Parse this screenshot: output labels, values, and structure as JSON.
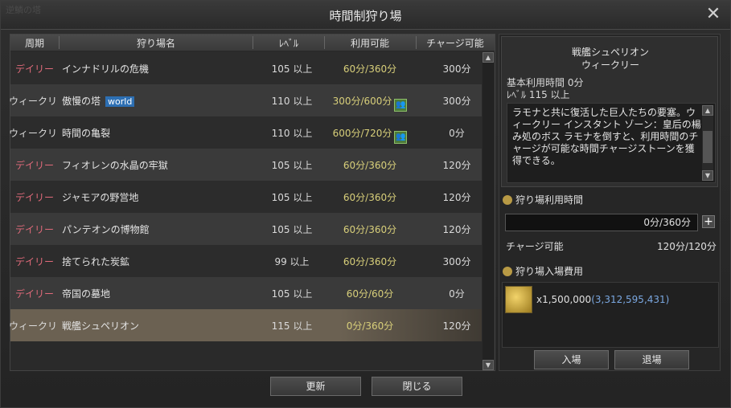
{
  "window": {
    "title": "時間制狩り場",
    "background_ghost_text": "逆鱗の塔"
  },
  "table": {
    "headers": [
      "周期",
      "狩り場名",
      "ﾚﾍﾞﾙ",
      "利用可能",
      "チャージ可能"
    ],
    "rows": [
      {
        "period": "デイリー",
        "period_type": "daily",
        "name": "インナドリルの危機",
        "badge": "",
        "party": false,
        "level": "105  以上",
        "usage": "60分/360分",
        "charge": "300分"
      },
      {
        "period": "ウィークリ",
        "period_type": "weekly",
        "name": "傲慢の塔",
        "badge": "world",
        "party": true,
        "level": "110  以上",
        "usage": "300分/600分",
        "charge": "300分"
      },
      {
        "period": "ウィークリ",
        "period_type": "weekly",
        "name": "時間の亀裂",
        "badge": "",
        "party": true,
        "level": "110  以上",
        "usage": "600分/720分",
        "charge": "0分"
      },
      {
        "period": "デイリー",
        "period_type": "daily",
        "name": "フィオレンの水晶の牢獄",
        "badge": "",
        "party": false,
        "level": "105  以上",
        "usage": "60分/360分",
        "charge": "120分"
      },
      {
        "period": "デイリー",
        "period_type": "daily",
        "name": "ジャモアの野営地",
        "badge": "",
        "party": false,
        "level": "105  以上",
        "usage": "60分/360分",
        "charge": "120分"
      },
      {
        "period": "デイリー",
        "period_type": "daily",
        "name": "パンテオンの博物館",
        "badge": "",
        "party": false,
        "level": "105  以上",
        "usage": "60分/360分",
        "charge": "120分"
      },
      {
        "period": "デイリー",
        "period_type": "daily",
        "name": "捨てられた炭鉱",
        "badge": "",
        "party": false,
        "level": "99  以上",
        "usage": "60分/360分",
        "charge": "300分"
      },
      {
        "period": "デイリー",
        "period_type": "daily",
        "name": "帝国の墓地",
        "badge": "",
        "party": false,
        "level": "105  以上",
        "usage": "60分/60分",
        "charge": "0分"
      },
      {
        "period": "ウィークリ",
        "period_type": "weekly",
        "name": "戦艦シュペリオン",
        "badge": "",
        "party": false,
        "level": "115  以上",
        "usage": "0分/360分",
        "charge": "120分",
        "selected": true
      }
    ]
  },
  "buttons": {
    "refresh": "更新",
    "close": "閉じる",
    "enter": "入場",
    "exit": "退場"
  },
  "detail": {
    "name": "戦艦シュペリオン",
    "period": "ウィークリー",
    "base_time": "基本利用時間 0分",
    "level": "ﾚﾍﾞﾙ 115  以上",
    "description": "ラモナと共に復活した巨人たちの要塞。ウィークリー インスタント ゾーン：皇后の楊み処のボス ラモナを倒すと、利用時間のチャージが可能な時間チャージストーンを獲得できる。",
    "usage_time_label": "狩り場利用時間",
    "usage_time_value": "0分/360分",
    "chargeable_label": "チャージ可能",
    "chargeable_value": "120分/120分",
    "fee_label": "狩り場入場費用",
    "fee_amount": "x1,500,000",
    "fee_owned": "(3,312,595,431)"
  },
  "colors": {
    "daily": "#e06a7a",
    "usage": "#d8cf7a",
    "world_badge": "#2d6fb3",
    "owned_adena": "#7aa7e0"
  }
}
